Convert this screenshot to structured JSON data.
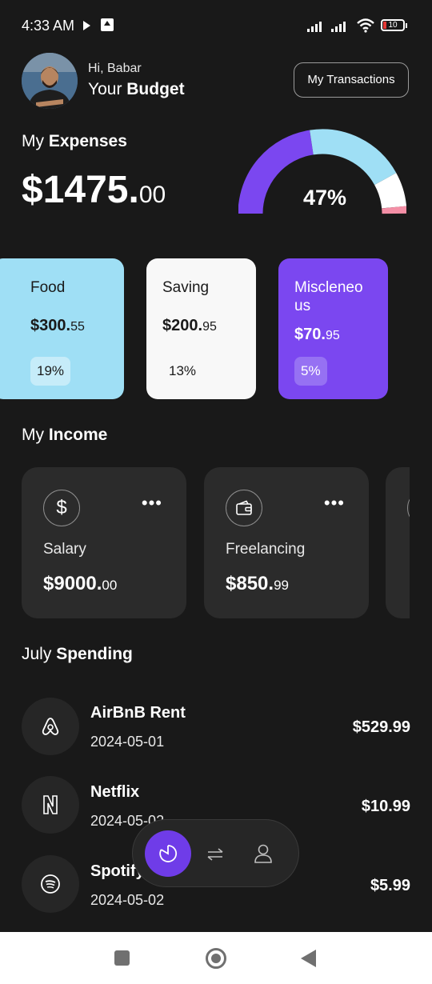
{
  "status_bar": {
    "time": "4:33 AM",
    "battery": "10"
  },
  "header": {
    "greeting": "Hi, Babar",
    "title_prefix": "Your ",
    "title_bold": "Budget",
    "transactions_button": "My Transactions"
  },
  "expenses": {
    "title_prefix": "My ",
    "title_bold": "Expenses",
    "amount_main": "$1475.",
    "amount_cents": "00",
    "gauge_percent": "47%",
    "gauge_colors": [
      "#7b47f0",
      "#9fdff5",
      "#ffffff",
      "#f48fa6"
    ]
  },
  "categories": [
    {
      "name": "Food",
      "amount_main": "$300.",
      "amount_cents": "55",
      "percent": "19%",
      "bg": "#9fdff5"
    },
    {
      "name": "Saving",
      "amount_main": "$200.",
      "amount_cents": "95",
      "percent": "13%",
      "bg": "#f8f8f8"
    },
    {
      "name": "Miscleneo us",
      "amount_main": "$70.",
      "amount_cents": "95",
      "percent": "5%",
      "bg": "#7b47f0"
    }
  ],
  "income": {
    "title_prefix": "My ",
    "title_bold": "Income",
    "items": [
      {
        "icon": "dollar-icon",
        "label": "Salary",
        "amount_main": "$9000.",
        "amount_cents": "00"
      },
      {
        "icon": "wallet-icon",
        "label": "Freelancing",
        "amount_main": "$850.",
        "amount_cents": "99"
      }
    ]
  },
  "spending": {
    "title_prefix": "July ",
    "title_bold": "Spending",
    "items": [
      {
        "icon": "airbnb-icon",
        "name": "AirBnB Rent",
        "date": "2024-05-01",
        "amount": "$529.99"
      },
      {
        "icon": "netflix-icon",
        "name": "Netflix",
        "date": "2024-05-02",
        "amount": "$10.99"
      },
      {
        "icon": "spotify-icon",
        "name": "Spotify",
        "date": "2024-05-02",
        "amount": "$5.99"
      }
    ]
  },
  "colors": {
    "background": "#191919",
    "accent": "#7b47f0",
    "card": "#2b2b2b"
  }
}
